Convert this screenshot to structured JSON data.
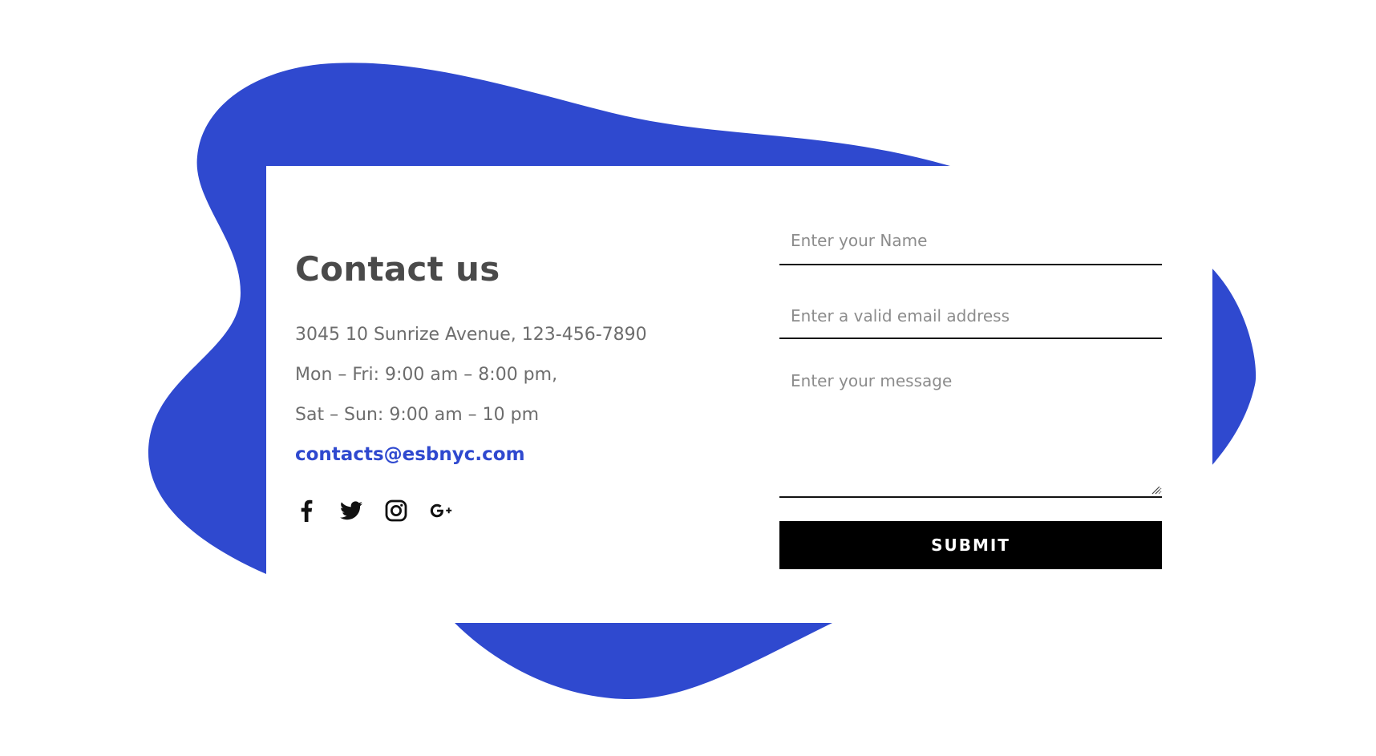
{
  "colors": {
    "accent_blob": "#2f49cf",
    "heading": "#4a4a4a",
    "body_text": "#6d6d6d",
    "email_link": "#2f49cf",
    "button_bg": "#000000",
    "button_text": "#ffffff"
  },
  "contact": {
    "title": "Contact us",
    "address": "3045 10 Sunrize Avenue, 123-456-7890",
    "hours_weekday": "Mon – Fri: 9:00 am – 8:00 pm,",
    "hours_weekend": "Sat – Sun: 9:00 am – 10 pm",
    "email": "contacts@esbnyc.com",
    "social": [
      "facebook-icon",
      "twitter-icon",
      "instagram-icon",
      "google-plus-icon"
    ]
  },
  "form": {
    "name_placeholder": "Enter your Name",
    "email_placeholder": "Enter a valid email address",
    "message_placeholder": "Enter your message",
    "submit_label": "SUBMIT"
  }
}
